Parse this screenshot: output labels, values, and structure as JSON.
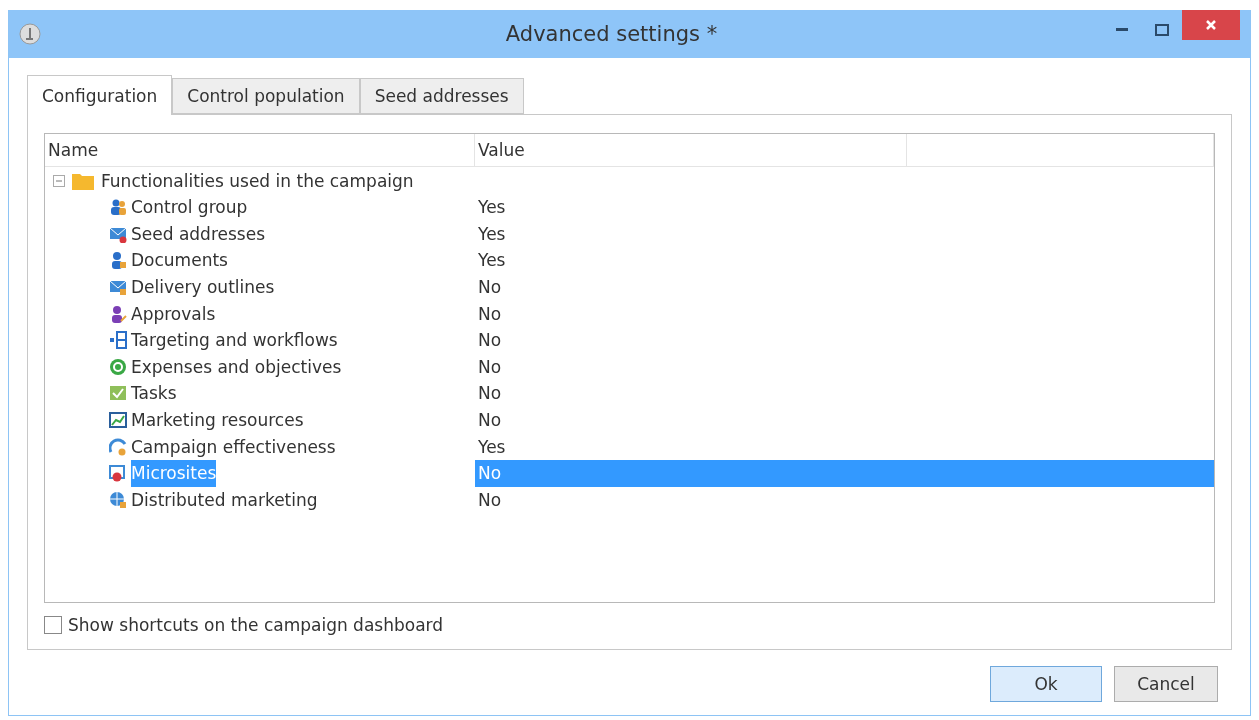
{
  "window": {
    "title": "Advanced settings *"
  },
  "tabs": [
    {
      "label": "Configuration",
      "selected": true
    },
    {
      "label": "Control population",
      "selected": false
    },
    {
      "label": "Seed addresses",
      "selected": false
    }
  ],
  "tree": {
    "columns": [
      "Name",
      "Value"
    ],
    "root": {
      "label": "Functionalities used in the campaign",
      "expanded": true,
      "children": [
        {
          "name": "Control group",
          "value": "Yes",
          "selected": false
        },
        {
          "name": "Seed addresses",
          "value": "Yes",
          "selected": false
        },
        {
          "name": "Documents",
          "value": "Yes",
          "selected": false
        },
        {
          "name": "Delivery outlines",
          "value": "No",
          "selected": false
        },
        {
          "name": "Approvals",
          "value": "No",
          "selected": false
        },
        {
          "name": "Targeting and workflows",
          "value": "No",
          "selected": false
        },
        {
          "name": "Expenses and objectives",
          "value": "No",
          "selected": false
        },
        {
          "name": "Tasks",
          "value": "No",
          "selected": false
        },
        {
          "name": "Marketing resources",
          "value": "No",
          "selected": false
        },
        {
          "name": "Campaign effectiveness",
          "value": "Yes",
          "selected": false
        },
        {
          "name": "Microsites",
          "value": "No",
          "selected": true
        },
        {
          "name": "Distributed marketing",
          "value": "No",
          "selected": false
        }
      ]
    }
  },
  "shortcuts_checkbox": {
    "label": "Show shortcuts on the campaign dashboard",
    "checked": false
  },
  "buttons": [
    {
      "label": "Ok",
      "default": true
    },
    {
      "label": "Cancel",
      "default": false
    }
  ]
}
